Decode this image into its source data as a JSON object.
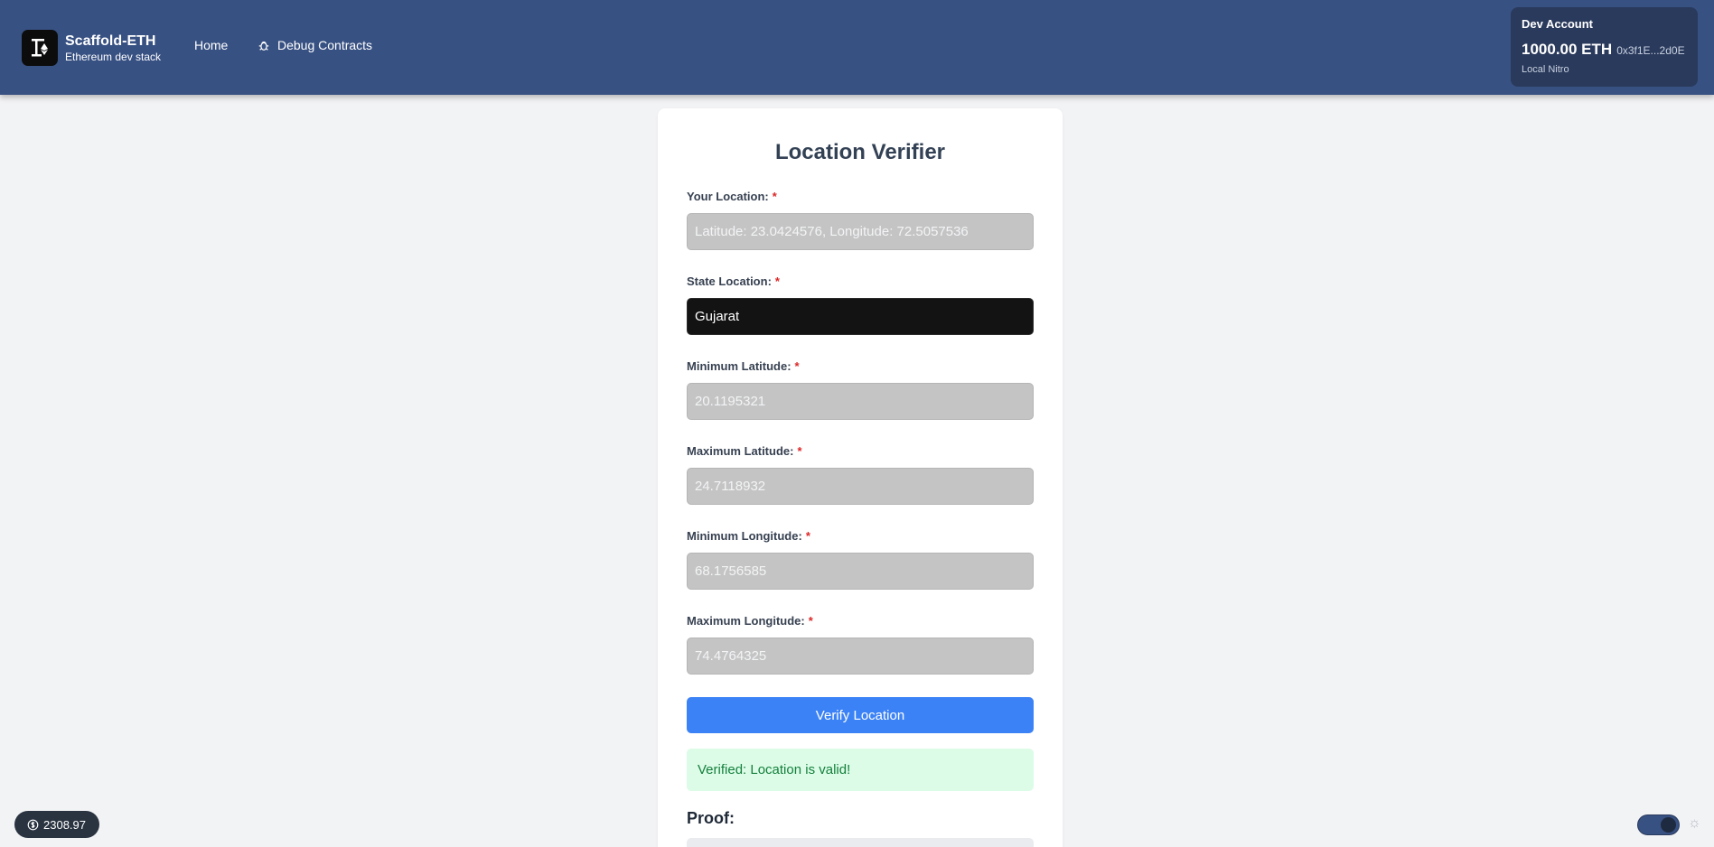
{
  "header": {
    "brand_title": "Scaffold-ETH",
    "brand_subtitle": "Ethereum dev stack",
    "nav": {
      "home": "Home",
      "debug": "Debug Contracts"
    },
    "account": {
      "title": "Dev Account",
      "balance": "1000.00 ETH",
      "address": "0x3f1E...2d0E",
      "network": "Local Nitro"
    }
  },
  "form": {
    "title": "Location Verifier",
    "required_mark": "*",
    "fields": [
      {
        "label": "Your Location:",
        "value": "Latitude: 23.0424576, Longitude: 72.5057536"
      },
      {
        "label": "State Location:",
        "value": "Gujarat"
      },
      {
        "label": "Minimum Latitude:",
        "value": "20.1195321"
      },
      {
        "label": "Maximum Latitude:",
        "value": "24.7118932"
      },
      {
        "label": "Minimum Longitude:",
        "value": "68.1756585"
      },
      {
        "label": "Maximum Longitude:",
        "value": "74.4764325"
      }
    ],
    "verify_label": "Verify Location",
    "success_message": "Verified: Location is valid!",
    "proof_label": "Proof:"
  },
  "footer": {
    "eth_price": "2308.97"
  },
  "icons": {
    "logo": "scaffold-logo-icon",
    "debug": "bug-icon",
    "price": "dollar-icon",
    "theme": "theme-toggle"
  },
  "colors": {
    "header_bg": "#385183",
    "primary": "#3b82f6",
    "success_bg": "#dcfce7",
    "success_text": "#15803d"
  }
}
